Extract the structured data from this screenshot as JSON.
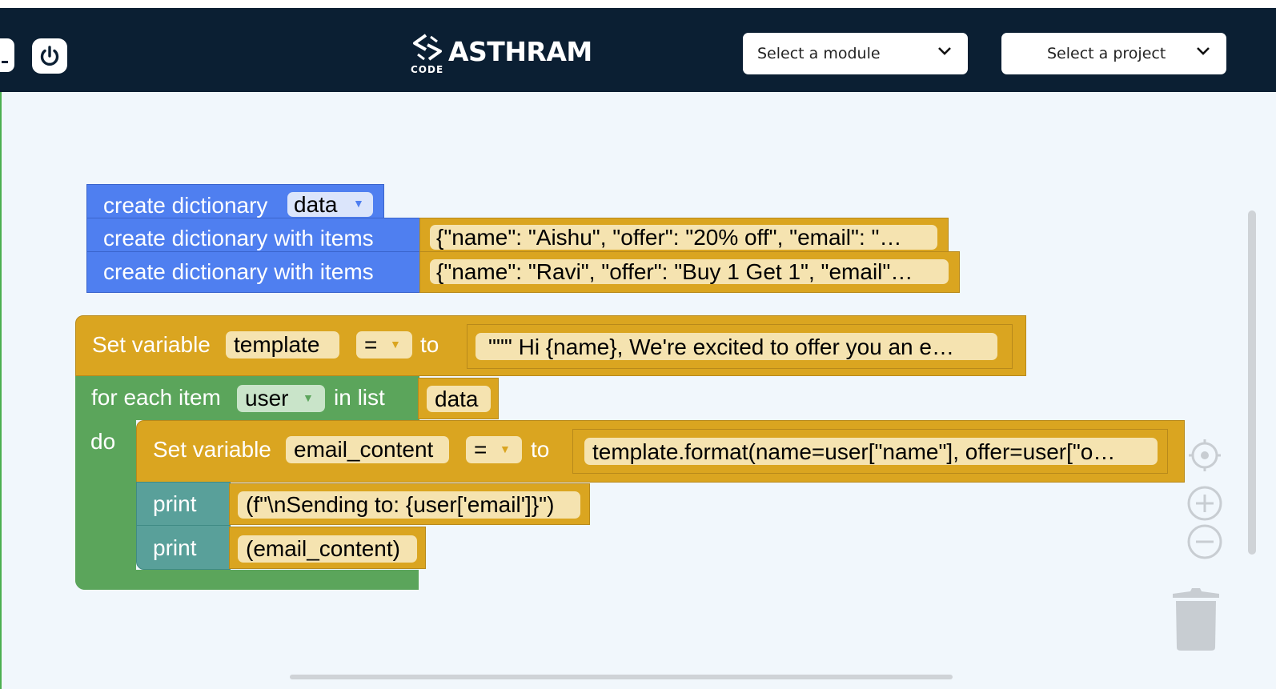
{
  "header": {
    "logo_text": "ASTHRAM",
    "logo_subtext": "CODE",
    "module_select": {
      "selected": "Select a module"
    },
    "project_select": {
      "selected": "Select a project"
    }
  },
  "blocks": {
    "dict_create": {
      "label": "create dictionary",
      "var": "data"
    },
    "dict_items_1": {
      "label": "create dictionary with items",
      "value": "{\"name\": \"Aishu\", \"offer\": \"20% off\", \"email\": \"…"
    },
    "dict_items_2": {
      "label": "create dictionary with items",
      "value": "{\"name\": \"Ravi\", \"offer\": \"Buy 1 Get 1\", \"email\"…"
    },
    "set_template": {
      "label": "Set variable",
      "var": "template",
      "op": "=",
      "to": "to",
      "value": "\"\"\" Hi {name},  We're excited to offer you an e…"
    },
    "for_each": {
      "label": "for each item",
      "var": "user",
      "in_list": "in list",
      "list": "data",
      "do": "do"
    },
    "set_email": {
      "label": "Set variable",
      "var": "email_content",
      "op": "=",
      "to": "to",
      "value": "template.format(name=user[\"name\"], offer=user[\"o…"
    },
    "print_1": {
      "label": "print",
      "value": "(f\"\\nSending to: {user['email']}\")"
    },
    "print_2": {
      "label": "print",
      "value": "(email_content)"
    }
  },
  "icons": {
    "power": "power-icon",
    "chevron": "chevron-down-icon",
    "recenter": "crosshair-icon",
    "zoom_in": "zoom-in-icon",
    "zoom_out": "zoom-out-icon",
    "trash": "trash-icon"
  },
  "colors": {
    "header_bg": "#0b1f33",
    "workspace_bg": "#f1f7fc",
    "dict_block": "#4f7ff0",
    "variable_block": "#daa520",
    "loop_block": "#5ba55b",
    "print_block": "#59a09a"
  }
}
